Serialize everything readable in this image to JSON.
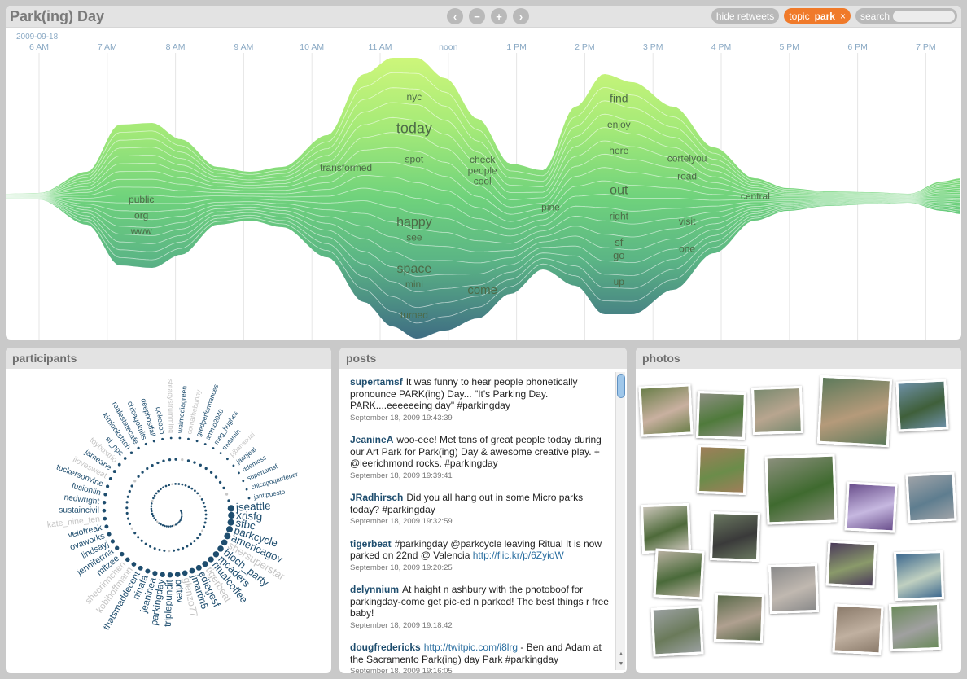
{
  "app": {
    "title": "Park(ing) Day"
  },
  "controls": {
    "hide_retweets": "hide retweets",
    "topic_label": "topic",
    "topic_value": "park",
    "topic_remove": "×",
    "search_label": "search"
  },
  "nav": {
    "prev": "‹",
    "zoom_out": "−",
    "zoom_in": "+",
    "next": "›"
  },
  "timeline": {
    "date": "2009-09-18",
    "ticks": [
      "6 AM",
      "7 AM",
      "8 AM",
      "9 AM",
      "10 AM",
      "11 AM",
      "noon",
      "1 PM",
      "2 PM",
      "3 PM",
      "4 PM",
      "5 PM",
      "6 PM",
      "7 PM"
    ],
    "topics": [
      {
        "t": "nyc",
        "at": "11 AM",
        "band": 2,
        "size": 12
      },
      {
        "t": "check",
        "at": "noon",
        "band": 3,
        "size": 12
      },
      {
        "t": "people",
        "at": "noon",
        "band": 4,
        "size": 12
      },
      {
        "t": "cool",
        "at": "noon",
        "band": 5,
        "size": 12
      },
      {
        "t": "today",
        "at": "11 AM",
        "band": 4,
        "size": 18
      },
      {
        "t": "transformed",
        "at": "10 AM",
        "band": 6,
        "size": 12
      },
      {
        "t": "spot",
        "at": "11 AM",
        "band": 6,
        "size": 12
      },
      {
        "t": "find",
        "at": "2 PM",
        "band": 1,
        "size": 14
      },
      {
        "t": "enjoy",
        "at": "2 PM",
        "band": 3,
        "size": 12
      },
      {
        "t": "here",
        "at": "2 PM",
        "band": 5,
        "size": 12
      },
      {
        "t": "cortelyou",
        "at": "3 PM",
        "band": 4,
        "size": 12
      },
      {
        "t": "road",
        "at": "3 PM",
        "band": 6,
        "size": 12
      },
      {
        "t": "pine",
        "at": "1 PM",
        "band": 7,
        "size": 12
      },
      {
        "t": "central",
        "at": "4 PM",
        "band": 7,
        "size": 12
      },
      {
        "t": "out",
        "at": "2 PM",
        "band": 8,
        "size": 16
      },
      {
        "t": "public",
        "at": "7 AM",
        "band": 9,
        "size": 12
      },
      {
        "t": "happy",
        "at": "11 AM",
        "band": 10,
        "size": 16
      },
      {
        "t": "right",
        "at": "2 PM",
        "band": 10,
        "size": 12
      },
      {
        "t": "org",
        "at": "7 AM",
        "band": 11,
        "size": 12
      },
      {
        "t": "see",
        "at": "11 AM",
        "band": 11,
        "size": 12
      },
      {
        "t": "visit",
        "at": "3 PM",
        "band": 11,
        "size": 12
      },
      {
        "t": "sf",
        "at": "2 PM",
        "band": 12,
        "size": 13
      },
      {
        "t": "www",
        "at": "7 AM",
        "band": 13,
        "size": 12
      },
      {
        "t": "space",
        "at": "11 AM",
        "band": 13,
        "size": 16
      },
      {
        "t": "go",
        "at": "2 PM",
        "band": 13,
        "size": 13
      },
      {
        "t": "one",
        "at": "3 PM",
        "band": 14,
        "size": 12
      },
      {
        "t": "mini",
        "at": "11 AM",
        "band": 14,
        "size": 12
      },
      {
        "t": "come",
        "at": "noon",
        "band": 15,
        "size": 15
      },
      {
        "t": "up",
        "at": "2 PM",
        "band": 15,
        "size": 12
      },
      {
        "t": "turned",
        "at": "11 AM",
        "band": 16,
        "size": 12
      }
    ]
  },
  "participants": {
    "title": "participants",
    "names": [
      "jseattle",
      "xrisfg",
      "sfbc",
      "parkcycle",
      "americagov",
      "shersuperstar",
      "bloch_party",
      "mcaders",
      "ritualcoffee",
      "tigerbeat",
      "ediegesf",
      "jmartin5",
      "glenzo77",
      "britev",
      "triplepundit",
      "parkingday",
      "jeaninea",
      "ninafa",
      "thatsmaddecent",
      "kobihoffmann",
      "sheorinnchen",
      "mitzee",
      "jenniferma",
      "lindsayj",
      "ovaworks",
      "velofreak",
      "kate_nine_ten",
      "sustaincivil",
      "nedwright",
      "fusionlin",
      "tuckersonvine",
      "ilovesweat",
      "jameane",
      "toyboxtrio",
      "sf_npc",
      "kimlockstitch",
      "realestatecafe",
      "chicagoknits",
      "deephostfall",
      "gokebob",
      "steadystrumming",
      "walmediagreen",
      "comathebunny",
      "gredperformances",
      "ammo2040",
      "meg_hughes",
      "mytamin",
      "pjbanacual",
      "jaanjeal",
      "ddemoss",
      "supertamsf",
      "chicagogardener",
      "jantipuesto"
    ]
  },
  "posts": {
    "title": "posts",
    "items": [
      {
        "user": "supertamsf",
        "text": "It was funny to hear people phonetically pronounce PARK(ing) Day... \"It's Parking Day. PARK....eeeeeeing day\" #parkingday",
        "link": "",
        "time": "September 18, 2009 19:43:39"
      },
      {
        "user": "JeanineA",
        "text": "woo-eee! Met tons of great people today during our Art Park for Park(ing) Day & awesome creative play. + @leerichmond rocks. #parkingday",
        "link": "",
        "time": "September 18, 2009 19:39:41"
      },
      {
        "user": "JRadhirsch",
        "text": "Did you all hang out in some Micro parks today? #parkingday",
        "link": "",
        "time": "September 18, 2009 19:32:59"
      },
      {
        "user": "tigerbeat",
        "text": "#parkingday @parkcycle leaving Ritual It is now parked on 22nd @ Valencia ",
        "link": "http://flic.kr/p/6ZyioW",
        "time": "September 18, 2009 19:20:25"
      },
      {
        "user": "delynnium",
        "text": "At haight n ashbury with the photoboof for parkingday-come get pic-ed n parked! The best things r free baby!",
        "link": "",
        "time": "September 18, 2009 19:18:42"
      },
      {
        "user": "dougfredericks",
        "text": " - Ben and Adam at the Sacramento Park(ing) day Park #parkingday",
        "link": "http://twitpic.com/i8lrg",
        "time": "September 18, 2009 19:16:05"
      }
    ]
  },
  "photos": {
    "title": "photos"
  },
  "colors": {
    "accent": "#f07a2a",
    "stream_light": "#cdf67a",
    "stream_mid": "#6fd27c",
    "stream_dark": "#3f6d83",
    "link": "#1e4d6e"
  }
}
